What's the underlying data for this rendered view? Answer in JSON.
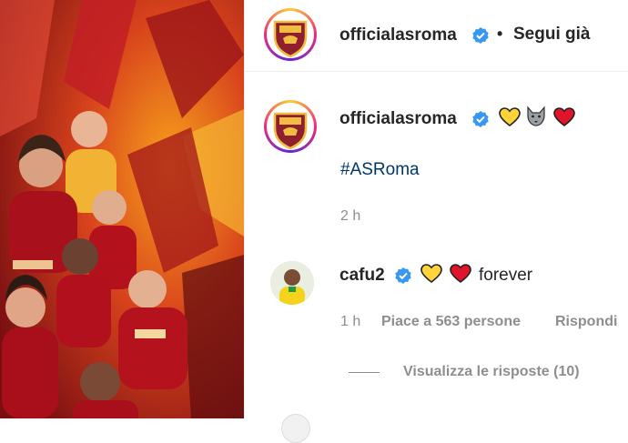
{
  "post": {
    "author": "officialasroma",
    "follow_label": "Segui già",
    "separator": "•"
  },
  "caption": {
    "author": "officialasroma",
    "hashtag": "#ASRoma",
    "time": "2 h"
  },
  "comment": {
    "author": "cafu2",
    "text": "forever",
    "time": "1 h",
    "likes": "Piace a 563 persone",
    "reply_label": "Rispondi",
    "view_replies": "Visualizza le risposte (10)"
  },
  "colors": {
    "verified": "#3897f0",
    "roma_red": "#8e1f2f",
    "roma_gold": "#f0bc42",
    "link": "#00376b",
    "muted": "#8e8e8e"
  },
  "icons": [
    "verified-badge-icon",
    "yellow-heart-icon",
    "wolf-icon",
    "red-heart-icon"
  ]
}
